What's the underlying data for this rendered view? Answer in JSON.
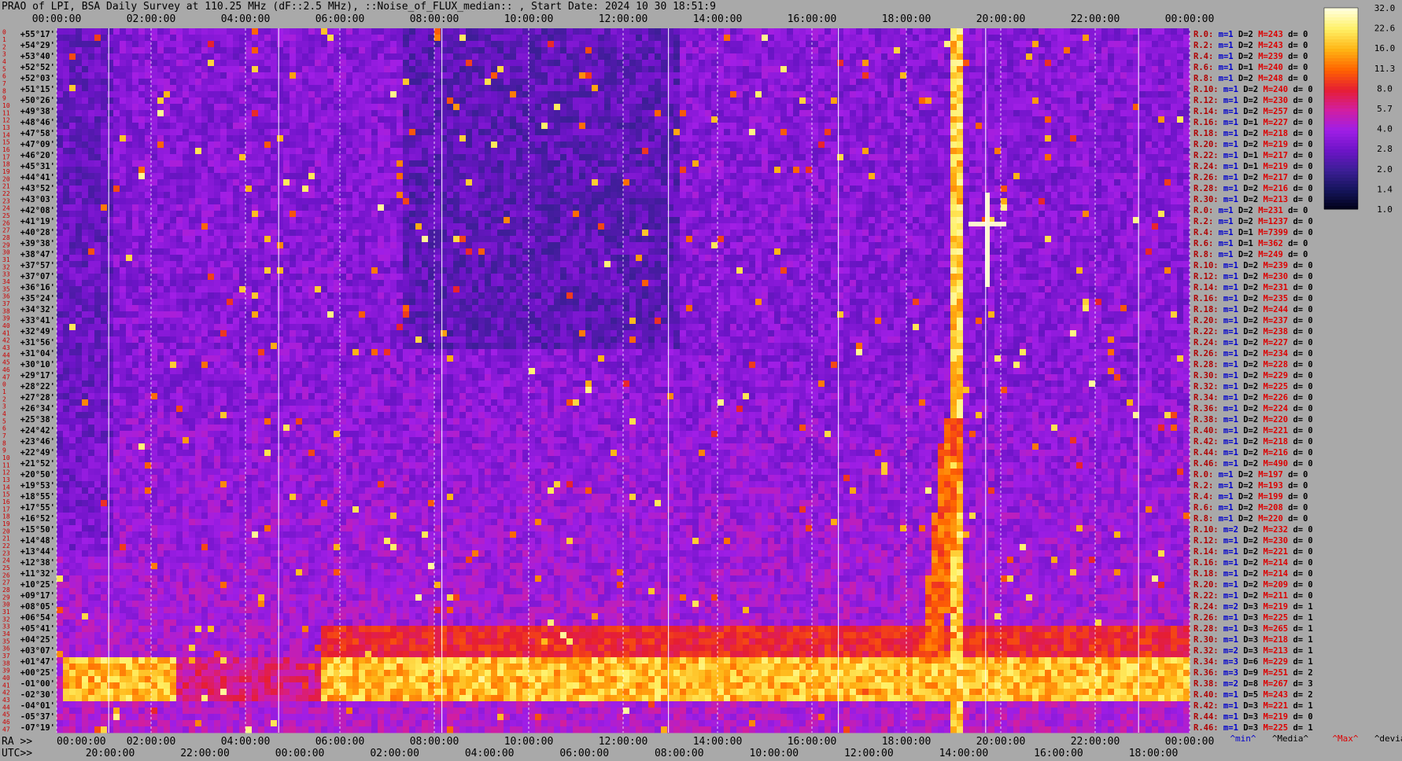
{
  "title": "PRAO of LPI, BSA Daily Survey at 110.25 MHz (dF::2.5 MHz), ::Noise_of_FLUX_median:: , Start Date: 2024 10 30 18:51:9",
  "chart_data": {
    "type": "heatmap",
    "title": "PRAO of LPI, BSA Daily Survey at 110.25 MHz (dF::2.5 MHz), ::Noise_of_FLUX_median:: , Start Date: 2024 10 30 18:51:9",
    "top_time_ticks": [
      "00:00:00",
      "02:00:00",
      "04:00:00",
      "06:00:00",
      "08:00:00",
      "10:00:00",
      "12:00:00",
      "14:00:00",
      "16:00:00",
      "18:00:00",
      "20:00:00",
      "22:00:00",
      "00:00:00"
    ],
    "ra_axis_label": "RA >>",
    "ra_ticks": [
      "00:00:00",
      "02:00:00",
      "04:00:00",
      "06:00:00",
      "08:00:00",
      "10:00:00",
      "12:00:00",
      "14:00:00",
      "16:00:00",
      "18:00:00",
      "20:00:00",
      "22:00:00",
      "00:00:00"
    ],
    "utc_axis_label": "UTC>>",
    "utc_ticks": [
      "20:00:00",
      "22:00:00",
      "00:00:00",
      "02:00:00",
      "04:00:00",
      "06:00:00",
      "08:00:00",
      "10:00:00",
      "12:00:00",
      "14:00:00",
      "16:00:00",
      "18:00:00"
    ],
    "beam_numbers": [
      "0",
      "1",
      "2",
      "3",
      "4",
      "5",
      "6",
      "7",
      "8",
      "9",
      "10",
      "11",
      "12",
      "13",
      "14",
      "15",
      "16",
      "17",
      "18",
      "19",
      "20",
      "21",
      "22",
      "23",
      "24",
      "25",
      "26",
      "27",
      "28",
      "29",
      "30",
      "31",
      "32",
      "33",
      "34",
      "35",
      "36",
      "37",
      "38",
      "39",
      "40",
      "41",
      "42",
      "43",
      "44",
      "45",
      "46",
      "47",
      "0",
      "1",
      "2",
      "3",
      "4",
      "5",
      "6",
      "7",
      "8",
      "9",
      "10",
      "11",
      "12",
      "13",
      "14",
      "15",
      "16",
      "17",
      "18",
      "19",
      "20",
      "21",
      "22",
      "23",
      "24",
      "25",
      "26",
      "27",
      "28",
      "29",
      "30",
      "31",
      "32",
      "33",
      "34",
      "35",
      "36",
      "37",
      "38",
      "39",
      "40",
      "41",
      "42",
      "43",
      "44",
      "45",
      "46",
      "47"
    ],
    "declinations": [
      "+55°17'",
      "+54°29'",
      "+53°40'",
      "+52°52'",
      "+52°03'",
      "+51°15'",
      "+50°26'",
      "+49°38'",
      "+48°46'",
      "+47°58'",
      "+47°09'",
      "+46°20'",
      "+45°31'",
      "+44°41'",
      "+43°52'",
      "+43°03'",
      "+42°08'",
      "+41°19'",
      "+40°28'",
      "+39°38'",
      "+38°47'",
      "+37°57'",
      "+37°07'",
      "+36°16'",
      "+35°24'",
      "+34°32'",
      "+33°41'",
      "+32°49'",
      "+31°56'",
      "+31°04'",
      "+30°10'",
      "+29°17'",
      "+28°22'",
      "+27°28'",
      "+26°34'",
      "+25°38'",
      "+24°42'",
      "+23°46'",
      "+22°49'",
      "+21°52'",
      "+20°50'",
      "+19°53'",
      "+18°55'",
      "+17°55'",
      "+16°52'",
      "+15°50'",
      "+14°48'",
      "+13°44'",
      "+12°38'",
      "+11°32'",
      "+10°25'",
      "+09°17'",
      "+08°05'",
      "+06°54'",
      "+05°41'",
      "+04°25'",
      "+03°07'",
      "+01°47'",
      "+00°25'",
      "-01°00'",
      "-02°30'",
      "-04°01'",
      "-05°37'",
      "-07°19'"
    ],
    "colorbar": {
      "min": 1.0,
      "max": 32.0,
      "ticks": [
        "32.0",
        "22.6",
        "16.0",
        "11.3",
        "8.0",
        "5.7",
        "4.0",
        "2.8",
        "2.0",
        "1.4",
        "1.0"
      ]
    },
    "right_stats": [
      {
        "r": "R.0:",
        "m": "m=1",
        "D": "D=2",
        "M": "M=243",
        "d": "d= 0"
      },
      {
        "r": "R.2:",
        "m": "m=1",
        "D": "D=2",
        "M": "M=243",
        "d": "d= 0"
      },
      {
        "r": "R.4:",
        "m": "m=1",
        "D": "D=2",
        "M": "M=239",
        "d": "d= 0"
      },
      {
        "r": "R.6:",
        "m": "m=1",
        "D": "D=1",
        "M": "M=240",
        "d": "d= 0"
      },
      {
        "r": "R.8:",
        "m": "m=1",
        "D": "D=2",
        "M": "M=248",
        "d": "d= 0"
      },
      {
        "r": "R.10:",
        "m": "m=1",
        "D": "D=2",
        "M": "M=240",
        "d": "d= 0"
      },
      {
        "r": "R.12:",
        "m": "m=1",
        "D": "D=2",
        "M": "M=230",
        "d": "d= 0"
      },
      {
        "r": "R.14:",
        "m": "m=1",
        "D": "D=2",
        "M": "M=257",
        "d": "d= 0"
      },
      {
        "r": "R.16:",
        "m": "m=1",
        "D": "D=1",
        "M": "M=227",
        "d": "d= 0"
      },
      {
        "r": "R.18:",
        "m": "m=1",
        "D": "D=2",
        "M": "M=218",
        "d": "d= 0"
      },
      {
        "r": "R.20:",
        "m": "m=1",
        "D": "D=2",
        "M": "M=219",
        "d": "d= 0"
      },
      {
        "r": "R.22:",
        "m": "m=1",
        "D": "D=1",
        "M": "M=217",
        "d": "d= 0"
      },
      {
        "r": "R.24:",
        "m": "m=1",
        "D": "D=1",
        "M": "M=219",
        "d": "d= 0"
      },
      {
        "r": "R.26:",
        "m": "m=1",
        "D": "D=2",
        "M": "M=217",
        "d": "d= 0"
      },
      {
        "r": "R.28:",
        "m": "m=1",
        "D": "D=2",
        "M": "M=216",
        "d": "d= 0"
      },
      {
        "r": "R.30:",
        "m": "m=1",
        "D": "D=2",
        "M": "M=213",
        "d": "d= 0"
      },
      {
        "r": "R.0:",
        "m": "m=1",
        "D": "D=2",
        "M": "M=231",
        "d": "d= 0"
      },
      {
        "r": "R.2:",
        "m": "m=1",
        "D": "D=2",
        "M": "M=1237",
        "d": "d= 0"
      },
      {
        "r": "R.4:",
        "m": "m=1",
        "D": "D=1",
        "M": "M=7399",
        "d": "d= 0"
      },
      {
        "r": "R.6:",
        "m": "m=1",
        "D": "D=1",
        "M": "M=362",
        "d": "d= 0"
      },
      {
        "r": "R.8:",
        "m": "m=1",
        "D": "D=2",
        "M": "M=249",
        "d": "d= 0"
      },
      {
        "r": "R.10:",
        "m": "m=1",
        "D": "D=2",
        "M": "M=239",
        "d": "d= 0"
      },
      {
        "r": "R.12:",
        "m": "m=1",
        "D": "D=2",
        "M": "M=230",
        "d": "d= 0"
      },
      {
        "r": "R.14:",
        "m": "m=1",
        "D": "D=2",
        "M": "M=231",
        "d": "d= 0"
      },
      {
        "r": "R.16:",
        "m": "m=1",
        "D": "D=2",
        "M": "M=235",
        "d": "d= 0"
      },
      {
        "r": "R.18:",
        "m": "m=1",
        "D": "D=2",
        "M": "M=244",
        "d": "d= 0"
      },
      {
        "r": "R.20:",
        "m": "m=1",
        "D": "D=2",
        "M": "M=237",
        "d": "d= 0"
      },
      {
        "r": "R.22:",
        "m": "m=1",
        "D": "D=2",
        "M": "M=238",
        "d": "d= 0"
      },
      {
        "r": "R.24:",
        "m": "m=1",
        "D": "D=2",
        "M": "M=227",
        "d": "d= 0"
      },
      {
        "r": "R.26:",
        "m": "m=1",
        "D": "D=2",
        "M": "M=234",
        "d": "d= 0"
      },
      {
        "r": "R.28:",
        "m": "m=1",
        "D": "D=2",
        "M": "M=228",
        "d": "d= 0"
      },
      {
        "r": "R.30:",
        "m": "m=1",
        "D": "D=2",
        "M": "M=229",
        "d": "d= 0"
      },
      {
        "r": "R.32:",
        "m": "m=1",
        "D": "D=2",
        "M": "M=225",
        "d": "d= 0"
      },
      {
        "r": "R.34:",
        "m": "m=1",
        "D": "D=2",
        "M": "M=226",
        "d": "d= 0"
      },
      {
        "r": "R.36:",
        "m": "m=1",
        "D": "D=2",
        "M": "M=224",
        "d": "d= 0"
      },
      {
        "r": "R.38:",
        "m": "m=1",
        "D": "D=2",
        "M": "M=220",
        "d": "d= 0"
      },
      {
        "r": "R.40:",
        "m": "m=1",
        "D": "D=2",
        "M": "M=221",
        "d": "d= 0"
      },
      {
        "r": "R.42:",
        "m": "m=1",
        "D": "D=2",
        "M": "M=218",
        "d": "d= 0"
      },
      {
        "r": "R.44:",
        "m": "m=1",
        "D": "D=2",
        "M": "M=216",
        "d": "d= 0"
      },
      {
        "r": "R.46:",
        "m": "m=1",
        "D": "D=2",
        "M": "M=490",
        "d": "d= 0"
      },
      {
        "r": "R.0:",
        "m": "m=1",
        "D": "D=2",
        "M": "M=197",
        "d": "d= 0"
      },
      {
        "r": "R.2:",
        "m": "m=1",
        "D": "D=2",
        "M": "M=193",
        "d": "d= 0"
      },
      {
        "r": "R.4:",
        "m": "m=1",
        "D": "D=2",
        "M": "M=199",
        "d": "d= 0"
      },
      {
        "r": "R.6:",
        "m": "m=1",
        "D": "D=2",
        "M": "M=208",
        "d": "d= 0"
      },
      {
        "r": "R.8:",
        "m": "m=1",
        "D": "D=2",
        "M": "M=220",
        "d": "d= 0"
      },
      {
        "r": "R.10:",
        "m": "m=2",
        "D": "D=2",
        "M": "M=232",
        "d": "d= 0"
      },
      {
        "r": "R.12:",
        "m": "m=1",
        "D": "D=2",
        "M": "M=230",
        "d": "d= 0"
      },
      {
        "r": "R.14:",
        "m": "m=1",
        "D": "D=2",
        "M": "M=221",
        "d": "d= 0"
      },
      {
        "r": "R.16:",
        "m": "m=1",
        "D": "D=2",
        "M": "M=214",
        "d": "d= 0"
      },
      {
        "r": "R.18:",
        "m": "m=1",
        "D": "D=2",
        "M": "M=214",
        "d": "d= 0"
      },
      {
        "r": "R.20:",
        "m": "m=1",
        "D": "D=2",
        "M": "M=209",
        "d": "d= 0"
      },
      {
        "r": "R.22:",
        "m": "m=1",
        "D": "D=2",
        "M": "M=211",
        "d": "d= 0"
      },
      {
        "r": "R.24:",
        "m": "m=2",
        "D": "D=3",
        "M": "M=219",
        "d": "d= 1"
      },
      {
        "r": "R.26:",
        "m": "m=1",
        "D": "D=3",
        "M": "M=225",
        "d": "d= 1"
      },
      {
        "r": "R.28:",
        "m": "m=1",
        "D": "D=3",
        "M": "M=265",
        "d": "d= 1"
      },
      {
        "r": "R.30:",
        "m": "m=1",
        "D": "D=3",
        "M": "M=218",
        "d": "d= 1"
      },
      {
        "r": "R.32:",
        "m": "m=2",
        "D": "D=3",
        "M": "M=213",
        "d": "d= 1"
      },
      {
        "r": "R.34:",
        "m": "m=3",
        "D": "D=6",
        "M": "M=229",
        "d": "d= 1"
      },
      {
        "r": "R.36:",
        "m": "m=3",
        "D": "D=9",
        "M": "M=251",
        "d": "d= 2"
      },
      {
        "r": "R.38:",
        "m": "m=2",
        "D": "D=8",
        "M": "M=267",
        "d": "d= 3"
      },
      {
        "r": "R.40:",
        "m": "m=1",
        "D": "D=5",
        "M": "M=243",
        "d": "d= 2"
      },
      {
        "r": "R.42:",
        "m": "m=1",
        "D": "D=3",
        "M": "M=221",
        "d": "d= 1"
      },
      {
        "r": "R.44:",
        "m": "m=1",
        "D": "D=3",
        "M": "M=219",
        "d": "d= 0"
      },
      {
        "r": "R.46:",
        "m": "m=1",
        "D": "D=3",
        "M": "M=225",
        "d": "d= 1"
      }
    ],
    "stats_legend": [
      "^min^",
      "^Media^",
      "^Max^",
      "^devia^"
    ],
    "colors": {
      "background": "#a9a9a9",
      "stat_label": "#b00000",
      "stat_min": "#0000cc",
      "stat_max": "#dd0000",
      "beam_number": "#cc0000",
      "palette": [
        "#000014",
        "#14145a",
        "#3c1e96",
        "#6e14c8",
        "#a01ee6",
        "#d21ea0",
        "#e61e32",
        "#ff6400",
        "#ffb414",
        "#fff064",
        "#ffffdc"
      ]
    },
    "features": {
      "bright_band_declinations": [
        "+01°47'",
        "+00°25'",
        "-01°00'"
      ],
      "bright_source_ra": "20:00",
      "bright_source_declination": "+41°19'"
    }
  }
}
